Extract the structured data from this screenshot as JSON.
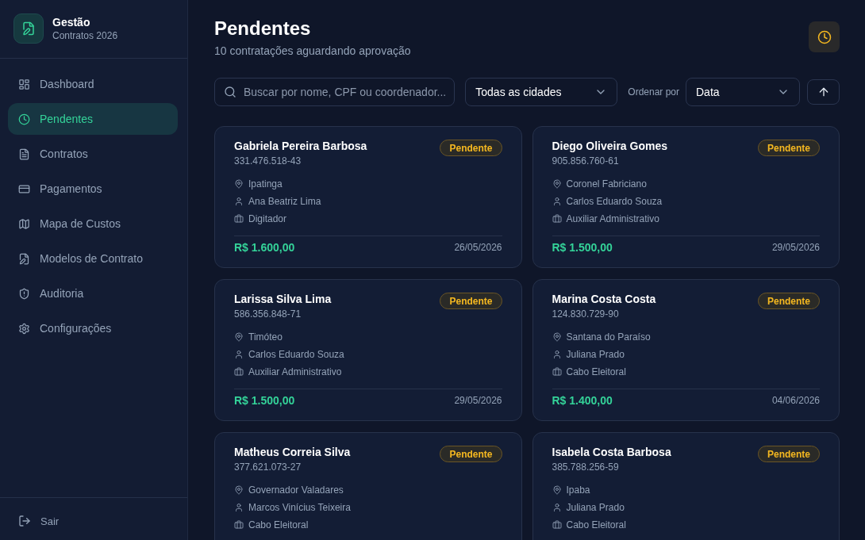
{
  "sidebar": {
    "brand": {
      "title": "Gestão",
      "subtitle": "Contratos 2026"
    },
    "nav": [
      {
        "label": "Dashboard",
        "selected": false
      },
      {
        "label": "Pendentes",
        "selected": true
      },
      {
        "label": "Contratos",
        "selected": false
      },
      {
        "label": "Pagamentos",
        "selected": false
      },
      {
        "label": "Mapa de Custos",
        "selected": false
      },
      {
        "label": "Modelos de Contrato",
        "selected": false
      },
      {
        "label": "Auditoria",
        "selected": false
      },
      {
        "label": "Configurações",
        "selected": false
      }
    ],
    "logout": {
      "label": "Sair"
    }
  },
  "header": {
    "title": "Pendentes",
    "subtitle": "10 contratações aguardando aprovação"
  },
  "filters": {
    "search": {
      "placeholder": "Buscar por nome, CPF ou coordenador..."
    },
    "city": {
      "value": "Todas as cidades"
    },
    "sort_label": "Ordenar por",
    "sort": {
      "value": "Data"
    }
  },
  "cards": [
    {
      "name": "Gabriela Pereira Barbosa",
      "cpf": "331.476.518-43",
      "status": "Pendente",
      "city": "Ipatinga",
      "coordinator": "Ana Beatriz Lima",
      "role": "Digitador",
      "amount": "R$ 1.600,00",
      "date": "26/05/2026"
    },
    {
      "name": "Diego Oliveira Gomes",
      "cpf": "905.856.760-61",
      "status": "Pendente",
      "city": "Coronel Fabriciano",
      "coordinator": "Carlos Eduardo Souza",
      "role": "Auxiliar Administrativo",
      "amount": "R$ 1.500,00",
      "date": "29/05/2026"
    },
    {
      "name": "Larissa Silva Lima",
      "cpf": "586.356.848-71",
      "status": "Pendente",
      "city": "Timóteo",
      "coordinator": "Carlos Eduardo Souza",
      "role": "Auxiliar Administrativo",
      "amount": "R$ 1.500,00",
      "date": "29/05/2026"
    },
    {
      "name": "Marina Costa Costa",
      "cpf": "124.830.729-90",
      "status": "Pendente",
      "city": "Santana do Paraíso",
      "coordinator": "Juliana Prado",
      "role": "Cabo Eleitoral",
      "amount": "R$ 1.400,00",
      "date": "04/06/2026"
    },
    {
      "name": "Matheus Correia Silva",
      "cpf": "377.621.073-27",
      "status": "Pendente",
      "city": "Governador Valadares",
      "coordinator": "Marcos Vinícius Teixeira",
      "role": "Cabo Eleitoral"
    },
    {
      "name": "Isabela Costa Barbosa",
      "cpf": "385.788.256-59",
      "status": "Pendente",
      "city": "Ipaba",
      "coordinator": "Juliana Prado",
      "role": "Cabo Eleitoral"
    }
  ]
}
